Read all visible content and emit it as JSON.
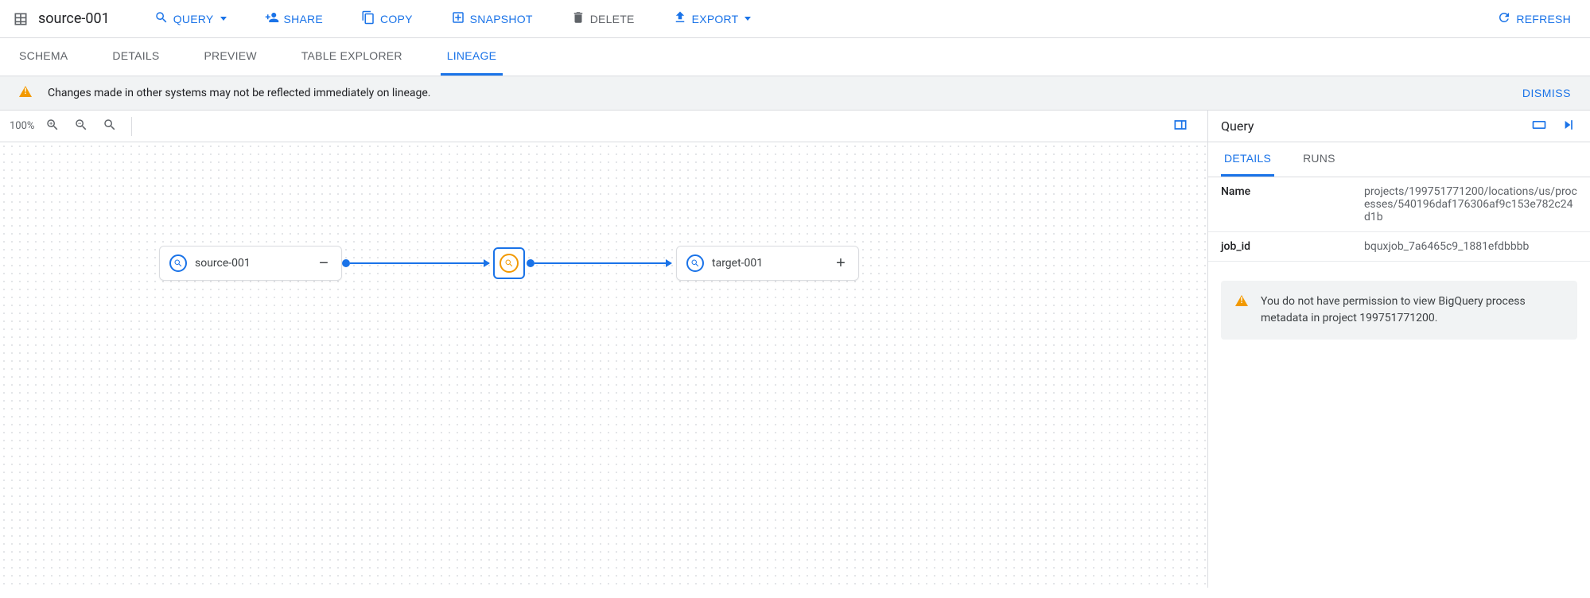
{
  "header": {
    "title": "source-001",
    "actions": {
      "query": "QUERY",
      "share": "SHARE",
      "copy": "COPY",
      "snapshot": "SNAPSHOT",
      "delete": "DELETE",
      "export": "EXPORT",
      "refresh": "REFRESH"
    }
  },
  "tabs": {
    "schema": "SCHEMA",
    "details": "DETAILS",
    "preview": "PREVIEW",
    "table_explorer": "TABLE EXPLORER",
    "lineage": "LINEAGE"
  },
  "banner": {
    "text": "Changes made in other systems may not be reflected immediately on lineage.",
    "dismiss": "DISMISS"
  },
  "canvas": {
    "zoom": "100%",
    "nodes": {
      "source": {
        "label": "source-001",
        "toggle": "−"
      },
      "target": {
        "label": "target-001",
        "toggle": "+"
      }
    }
  },
  "side": {
    "title": "Query",
    "tabs": {
      "details": "DETAILS",
      "runs": "RUNS"
    },
    "kv": [
      {
        "key": "Name",
        "val": "projects/199751771200/locations/us/processes/540196daf176306af9c153e782c24d1b"
      },
      {
        "key": "job_id",
        "val": "bquxjob_7a6465c9_1881efdbbbb"
      }
    ],
    "warning": "You do not have permission to view BigQuery process metadata in project 199751771200."
  }
}
